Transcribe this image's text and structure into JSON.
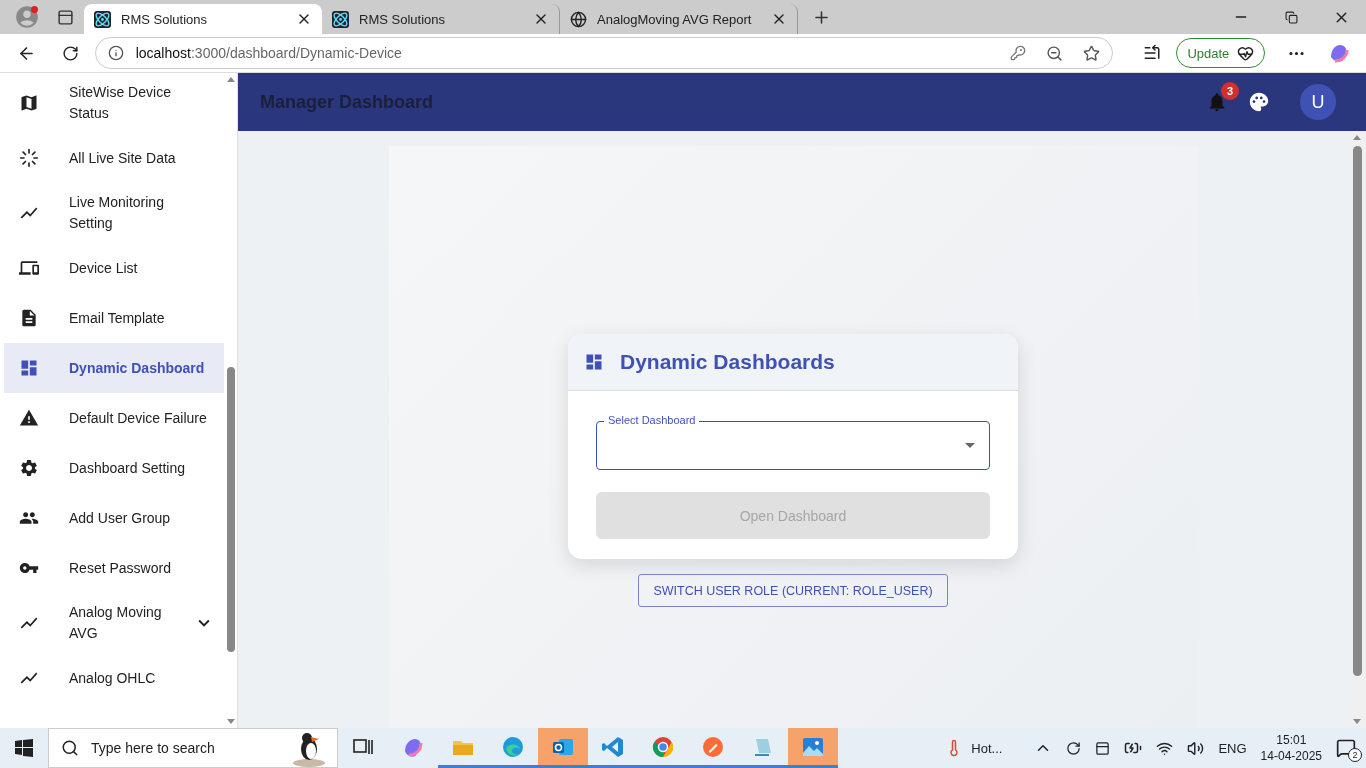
{
  "browser": {
    "tabs": [
      {
        "title": "RMS Solutions",
        "kind": "atom",
        "selected": true
      },
      {
        "title": "RMS Solutions",
        "kind": "atom",
        "selected": false
      },
      {
        "title": "AnalogMoving AVG Report",
        "kind": "globe",
        "selected": false
      }
    ],
    "url": {
      "host": "localhost",
      "path": ":3000/dashboard/Dynamic-Device"
    },
    "update_button": "Update"
  },
  "header": {
    "title": "Manager Dashboard",
    "notifications": "3",
    "avatar": "U"
  },
  "sidebar": {
    "items": [
      {
        "label": "SiteWise Device Status",
        "selected": false,
        "expandable": false
      },
      {
        "label": "All Live Site Data",
        "selected": false,
        "expandable": false
      },
      {
        "label": "Live Monitoring Setting",
        "selected": false,
        "expandable": false
      },
      {
        "label": "Device List",
        "selected": false,
        "expandable": false
      },
      {
        "label": "Email Template",
        "selected": false,
        "expandable": false
      },
      {
        "label": "Dynamic Dashboard",
        "selected": true,
        "expandable": false
      },
      {
        "label": "Default Device Failure",
        "selected": false,
        "expandable": false
      },
      {
        "label": "Dashboard Setting",
        "selected": false,
        "expandable": false
      },
      {
        "label": "Add User Group",
        "selected": false,
        "expandable": false
      },
      {
        "label": "Reset Password",
        "selected": false,
        "expandable": false
      },
      {
        "label": "Analog Moving AVG",
        "selected": false,
        "expandable": true
      },
      {
        "label": "Analog OHLC",
        "selected": false,
        "expandable": false
      }
    ]
  },
  "card": {
    "title": "Dynamic Dashboards",
    "select_label": "Select Dashboard",
    "open_button": {
      "label": "Open Dashboard",
      "disabled": true
    }
  },
  "switch_role_button": "SWITCH USER ROLE (CURRENT: ROLE_USER)",
  "taskbar": {
    "search_placeholder": "Type here to search",
    "apps": [
      {
        "kind": "taskview",
        "running": false,
        "active": false
      },
      {
        "kind": "swirl",
        "running": false,
        "active": false
      },
      {
        "kind": "folder",
        "running": true,
        "active": false
      },
      {
        "kind": "wave",
        "running": true,
        "active": false
      },
      {
        "kind": "mail",
        "running": true,
        "active": true
      },
      {
        "kind": "code",
        "running": true,
        "active": false
      },
      {
        "kind": "circle",
        "running": true,
        "active": false
      },
      {
        "kind": "pen",
        "running": true,
        "active": false
      },
      {
        "kind": "notepad",
        "running": true,
        "active": false
      },
      {
        "kind": "image",
        "running": true,
        "active": true
      }
    ],
    "weather": "Hot...",
    "language": "ENG",
    "time": "15:01",
    "date": "14-04-2025",
    "notifications": "2"
  }
}
